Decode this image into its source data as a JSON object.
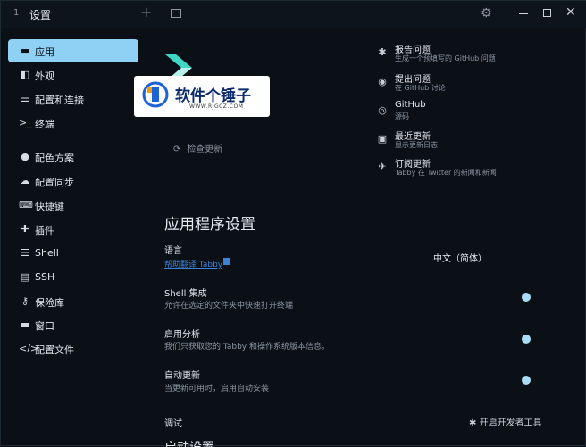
{
  "titlebar": {
    "tab_index": "1",
    "title": "设置",
    "new_tab": "+"
  },
  "sidebar": {
    "items": [
      {
        "label": "应用",
        "icon": "window-icon",
        "glyph": "▬"
      },
      {
        "label": "外观",
        "icon": "palette-icon",
        "glyph": "◧"
      },
      {
        "label": "配置和连接",
        "icon": "sliders-icon",
        "glyph": "☰"
      },
      {
        "label": "终端",
        "icon": "terminal-icon",
        "glyph": ">_"
      },
      {
        "label": "配色方案",
        "icon": "color-palette-icon",
        "glyph": "●"
      },
      {
        "label": "配置同步",
        "icon": "cloud-icon",
        "glyph": "☁"
      },
      {
        "label": "快捷键",
        "icon": "keyboard-icon",
        "glyph": "⌨"
      },
      {
        "label": "插件",
        "icon": "puzzle-icon",
        "glyph": "✚"
      },
      {
        "label": "Shell",
        "icon": "list-icon",
        "glyph": "☰"
      },
      {
        "label": "SSH",
        "icon": "server-icon",
        "glyph": "▤"
      },
      {
        "label": "保险库",
        "icon": "key-icon",
        "glyph": "⚷"
      },
      {
        "label": "窗口",
        "icon": "window-icon",
        "glyph": "▬"
      },
      {
        "label": "配置文件",
        "icon": "code-icon",
        "glyph": "</>"
      }
    ]
  },
  "logo": {
    "text": "软件个锤子",
    "sub": "WWW.RJGCZ.COM"
  },
  "check_updates": "检查更新",
  "links": [
    {
      "title": "报告问题",
      "subtitle": "生成一个预填写的 GitHub 问题",
      "icon": "bug-icon",
      "glyph": "✱"
    },
    {
      "title": "提出问题",
      "subtitle": "在 GitHub 讨论",
      "icon": "chat-icon",
      "glyph": "◉"
    },
    {
      "title": "GitHub",
      "subtitle": "源码",
      "icon": "github-icon",
      "glyph": "◎"
    },
    {
      "title": "最近更新",
      "subtitle": "显示更新日志",
      "icon": "book-icon",
      "glyph": "▣"
    },
    {
      "title": "订阅更新",
      "subtitle": "Tabby 在 Twitter 的新闻和新闻",
      "icon": "twitter-icon",
      "glyph": "✈"
    }
  ],
  "settings": {
    "heading": "应用程序设置",
    "language": {
      "label": "语言",
      "link": "帮助翻译 Tabby",
      "value": "中文（简体）"
    },
    "shell_integration": {
      "label": "Shell 集成",
      "desc": "允许在选定的文件夹中快速打开终端"
    },
    "analytics": {
      "label": "启用分析",
      "desc": "我们只获取您的 Tabby 和操作系统版本信息。"
    },
    "auto_update": {
      "label": "自动更新",
      "desc": "当更新可用时，启用自动安装"
    },
    "debug": {
      "label": "调试",
      "devtools": "开启开发者工具"
    },
    "bottom_partial": "启动设置"
  }
}
